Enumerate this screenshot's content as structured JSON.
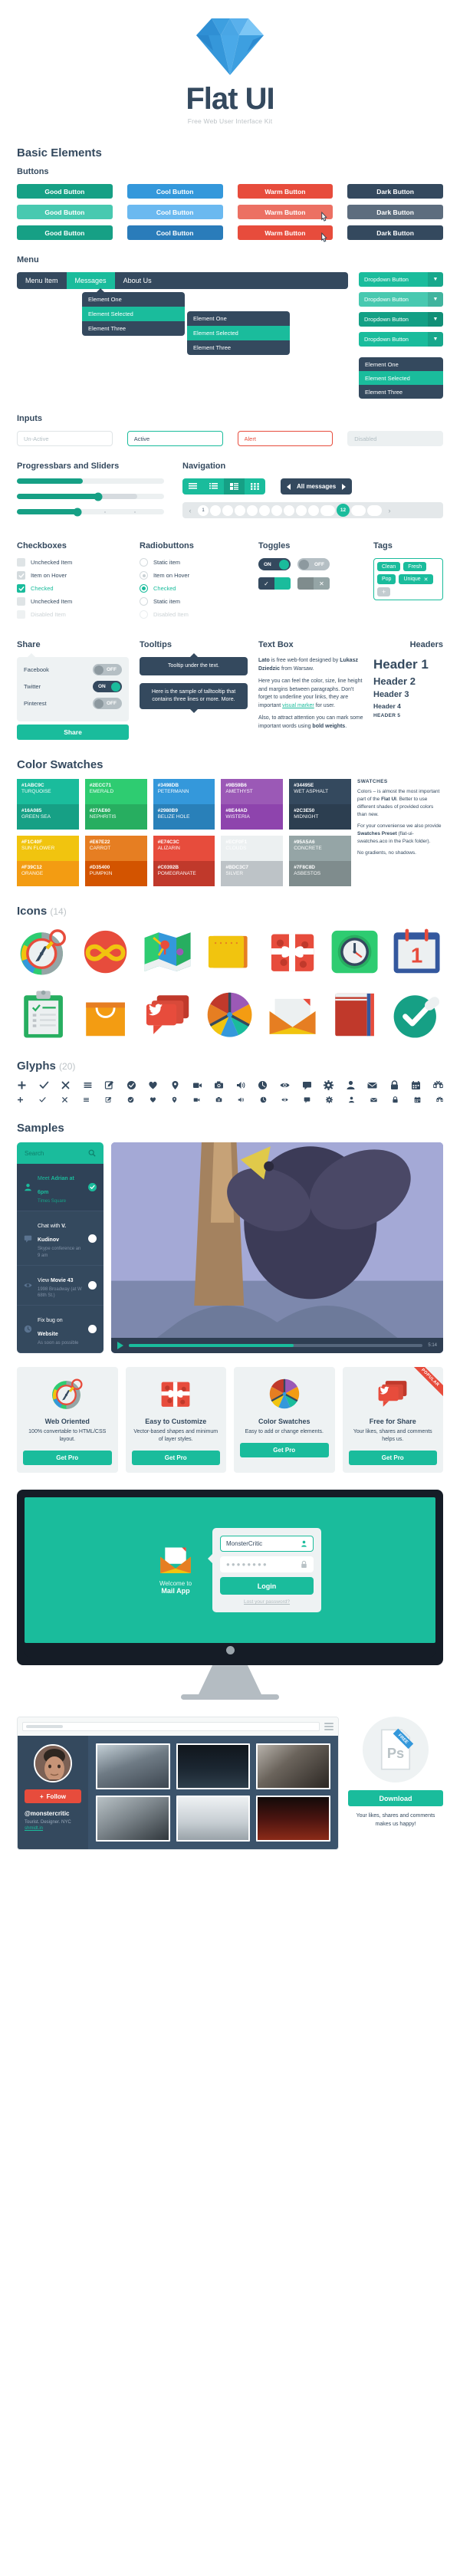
{
  "hero": {
    "title": "Flat UI",
    "subtitle": "Free Web User Interface Kit",
    "logo_icon": "diamond-icon"
  },
  "sections": {
    "basic_elements": "Basic Elements",
    "buttons": "Buttons",
    "menu": "Menu",
    "inputs": "Inputs",
    "progressbars": "Progressbars and Sliders",
    "navigation": "Navigation",
    "checkboxes": "Checkboxes",
    "radiobuttons": "Radiobuttons",
    "toggles": "Toggles",
    "tags": "Tags",
    "share": "Share",
    "tooltips": "Tooltips",
    "textbox": "Text Box",
    "headers": "Headers",
    "color_swatches": "Color Swatches",
    "icons": "Icons",
    "icons_count": "(14)",
    "glyphs": "Glyphs",
    "glyphs_count": "(20)",
    "samples": "Samples"
  },
  "buttons": {
    "rows": [
      [
        {
          "label": "Good Button",
          "cls": "b-good"
        },
        {
          "label": "Cool Button",
          "cls": "b-cool"
        },
        {
          "label": "Warm Button",
          "cls": "b-warm"
        },
        {
          "label": "Dark Button",
          "cls": "b-dark"
        }
      ],
      [
        {
          "label": "Good Button",
          "cls": "b-good-l"
        },
        {
          "label": "Cool Button",
          "cls": "b-cool-l"
        },
        {
          "label": "Warm Button",
          "cls": "b-warm-l"
        },
        {
          "label": "Dark Button",
          "cls": "b-dark-l"
        }
      ],
      [
        {
          "label": "Good Button",
          "cls": "b-good"
        },
        {
          "label": "Cool Button",
          "cls": "b-cool-d"
        },
        {
          "label": "Warm Button",
          "cls": "b-warm"
        },
        {
          "label": "Dark Button",
          "cls": "b-dark"
        }
      ]
    ]
  },
  "menu": {
    "items": [
      {
        "label": "Menu Item",
        "active": false
      },
      {
        "label": "Messages",
        "active": true
      },
      {
        "label": "About Us",
        "active": false
      }
    ],
    "popover_items": [
      "Element One",
      "Element Selected",
      "Element Three"
    ],
    "dropdown_label": "Dropdown Button",
    "dropdown_caret": "▼",
    "dropdown_items": [
      "Element One",
      "Element Selected",
      "Element Three"
    ]
  },
  "inputs": [
    {
      "value": "",
      "placeholder": "Un-Active",
      "state": ""
    },
    {
      "value": "Active",
      "placeholder": "",
      "state": "active"
    },
    {
      "value": "Alert",
      "placeholder": "",
      "state": "alert"
    },
    {
      "value": "",
      "placeholder": "Disabled",
      "state": "disabled"
    }
  ],
  "sliders": [
    {
      "fill": 45,
      "knob": null,
      "secondary": null
    },
    {
      "fill": 55,
      "knob": 55,
      "secondary": 82
    },
    {
      "fill": 41,
      "knob": 41,
      "secondary": null
    }
  ],
  "navigation": {
    "view_icons": [
      "list-rows-icon",
      "list-lines-icon",
      "list-detail-icon",
      "grid-icon"
    ],
    "view_active_index": 2,
    "all_messages": "All messages",
    "pager": {
      "prev": "‹",
      "next": "›",
      "pages": [
        "1",
        "",
        "",
        "",
        "",
        "",
        "",
        "",
        "",
        "",
        ""
      ],
      "current": "12",
      "after": [
        "",
        ""
      ]
    }
  },
  "checkboxes": [
    {
      "label": "Unchecked Item",
      "state": "unchecked"
    },
    {
      "label": "Item on Hover",
      "state": "hover"
    },
    {
      "label": "Checked",
      "state": "checked"
    },
    {
      "label": "Unchecked Item",
      "state": "unchecked"
    },
    {
      "label": "Disabled Item",
      "state": "disabled"
    }
  ],
  "radiobuttons": [
    {
      "label": "Static item",
      "state": "static"
    },
    {
      "label": "Item on Hover",
      "state": "hover"
    },
    {
      "label": "Checked",
      "state": "checked"
    },
    {
      "label": "Static item",
      "state": "static"
    },
    {
      "label": "Disabled Item",
      "state": "disabled"
    }
  ],
  "toggles": {
    "on_label": "ON",
    "off_label": "OFF",
    "check_glyph": "✓",
    "cross_glyph": "✕"
  },
  "tags": {
    "items": [
      "Clean",
      "Fresh",
      "Pop",
      "Unique"
    ],
    "removable": "Unique",
    "remove_glyph": "✕",
    "add_glyph": "+"
  },
  "share": {
    "rows": [
      {
        "label": "Facebook",
        "state": "off",
        "text": "OFF"
      },
      {
        "label": "Twitter",
        "state": "on",
        "text": "ON"
      },
      {
        "label": "Pinterest",
        "state": "off",
        "text": "OFF"
      }
    ],
    "button": "Share"
  },
  "tooltips": {
    "short": "Tooltip under the text.",
    "long": "Here is the sample of talltooltip that contains three lines or more. More."
  },
  "textbox": {
    "p1_a": "Lato",
    "p1_b": " is free web-font designed by ",
    "p1_c": "Lukasz Dziedzic",
    "p1_d": " from Warsaw.",
    "p2_a": "Here you can feel the color, size, line height and margins between paragraphs. Don't forget to underline your links, they are important ",
    "p2_link": "visual marker",
    "p2_b": " for user.",
    "p3_a": "Also, to attract attention you can mark some important words using ",
    "p3_b": "bold weights",
    "p3_c": "."
  },
  "headers": {
    "h1": "Header 1",
    "h2": "Header 2",
    "h3": "Header 3",
    "h4": "Header 4",
    "h5": "HEADER 5"
  },
  "color_swatches": {
    "columns": [
      [
        {
          "hex": "#1ABC9C",
          "name": "TURQUOISE",
          "color": "#1abc9c"
        },
        {
          "hex": "#16A085",
          "name": "GREEN SEA",
          "color": "#16a085"
        }
      ],
      [
        {
          "hex": "#2ECC71",
          "name": "EMERALD",
          "color": "#2ecc71"
        },
        {
          "hex": "#27AE60",
          "name": "NEPHRITIS",
          "color": "#27ae60"
        }
      ],
      [
        {
          "hex": "#3498DB",
          "name": "PETERMANN",
          "color": "#3498db"
        },
        {
          "hex": "#2980B9",
          "name": "BELIZE HOLE",
          "color": "#2980b9"
        }
      ],
      [
        {
          "hex": "#9B59B6",
          "name": "AMETHYST",
          "color": "#9b59b6"
        },
        {
          "hex": "#8E44AD",
          "name": "WISTERIA",
          "color": "#8e44ad"
        }
      ],
      [
        {
          "hex": "#34495E",
          "name": "WET ASPHALT",
          "color": "#34495e"
        },
        {
          "hex": "#2C3E50",
          "name": "MIDNIGHT",
          "color": "#2c3e50"
        }
      ],
      [
        {
          "hex": "#F1C40F",
          "name": "SUN FLOWER",
          "color": "#f1c40f"
        },
        {
          "hex": "#F39C12",
          "name": "ORANGE",
          "color": "#f39c12"
        }
      ],
      [
        {
          "hex": "#E67E22",
          "name": "CARROT",
          "color": "#e67e22"
        },
        {
          "hex": "#D35400",
          "name": "PUMPKIN",
          "color": "#d35400"
        }
      ],
      [
        {
          "hex": "#E74C3C",
          "name": "ALIZARIN",
          "color": "#e74c3c"
        },
        {
          "hex": "#C0392B",
          "name": "POMEGRANATE",
          "color": "#c0392b"
        }
      ],
      [
        {
          "hex": "#ECF0F1",
          "name": "CLOUDS",
          "color": "#ecf0f1",
          "dark_text": true
        },
        {
          "hex": "#BDC3C7",
          "name": "SILVER",
          "color": "#bdc3c7"
        }
      ],
      [
        {
          "hex": "#95A5A6",
          "name": "CONCRETE",
          "color": "#95a5a6"
        },
        {
          "hex": "#7F8C8D",
          "name": "ASBESTOS",
          "color": "#7f8c8d"
        }
      ]
    ],
    "side": {
      "title": "SWATCHES",
      "p1_a": "Colors – is almost the most important part of the ",
      "p1_b": "Flat UI",
      "p1_c": ". Better to use different shades of provided colors than new.",
      "p2_a": "For your conveniense we also provide ",
      "p2_b": "Swatches Preset",
      "p2_c": " (flat-ui-swatches.aco in the Pack folder).",
      "p3": "No gradients, no shadows."
    }
  },
  "icons": [
    "compass-icon",
    "infinity-heart-icon",
    "map-icon",
    "notepad-icon",
    "gift-icon",
    "clock-icon",
    "calendar-icon",
    "clipboard-icon",
    "shopping-bag-icon",
    "twitter-chat-icon",
    "color-wheel-icon",
    "envelope-icon",
    "notebook-icon",
    "check-circle-icon"
  ],
  "glyphs": [
    "plus-glyph",
    "check-glyph",
    "close-glyph",
    "menu-glyph",
    "edit-glyph",
    "check-circle-glyph",
    "heart-glyph",
    "pin-glyph",
    "video-glyph",
    "camera-glyph",
    "volume-glyph",
    "clock-glyph",
    "eye-glyph",
    "comment-glyph",
    "gear-glyph",
    "user-glyph",
    "mail-glyph",
    "lock-glyph",
    "calendar-glyph",
    "command-glyph"
  ],
  "todo_app": {
    "search_placeholder": "Search",
    "search_icon": "search-icon",
    "items": [
      {
        "title_a": "Meet ",
        "title_b": "Adrian at 6pm",
        "sub": "Times Square",
        "icon": "user-icon",
        "done": true
      },
      {
        "title_a": "Chat with ",
        "title_b": "V. Kudinov",
        "sub": "Skype conference an 9 am",
        "icon": "comment-icon",
        "done": false
      },
      {
        "title_a": "View ",
        "title_b": "Movie 43",
        "sub": "1998 Broadway (at W 68th St.)",
        "icon": "eye-icon",
        "done": false
      },
      {
        "title_a": "Fix bug on ",
        "title_b": "Website",
        "sub": "As soon as possible",
        "icon": "clock-icon",
        "done": false
      }
    ]
  },
  "player": {
    "play_icon": "play-icon",
    "time": "5:14",
    "progress": 56
  },
  "features": [
    {
      "title": "Web Oriented",
      "desc": "100% convertable to HTML/CSS layout.",
      "button": "Get Pro",
      "icon": "compass-icon",
      "ribbon": ""
    },
    {
      "title": "Easy to Customize",
      "desc": "Vector-based shapes and minimum of layer styles.",
      "button": "Get Pro",
      "icon": "gift-icon",
      "ribbon": ""
    },
    {
      "title": "Color Swatches",
      "desc": "Easy to add or change elements.",
      "button": "Get Pro",
      "icon": "color-wheel-icon",
      "ribbon": ""
    },
    {
      "title": "Free for Share",
      "desc": "Your likes, shares and comments helps us.",
      "button": "Get Pro",
      "icon": "twitter-chat-icon",
      "ribbon": "POPULAR"
    }
  ],
  "mail_app": {
    "welcome_line1": "Welcome to",
    "welcome_line2": "Mail App",
    "username": "MonsterCritic",
    "password_dots": "●●●●●●●●",
    "login_button": "Login",
    "lost_password": "Lost your password?",
    "user_icon": "user-icon",
    "lock_icon": "lock-icon",
    "envelope_icon": "envelope-icon"
  },
  "gallery": {
    "follow_button": "Follow",
    "follow_plus": "+",
    "handle": "@monstercritic",
    "bio": "Tourist. Designer. NYC",
    "link": "shmidt.in",
    "menu_icon": "hamburger-icon"
  },
  "download": {
    "badge": "FREE",
    "file_label": "Ps",
    "button": "Download",
    "note": "Your likes, shares and comments makes us happy!"
  },
  "colors": {
    "turquoise": "#1abc9c",
    "green_sea": "#16a085",
    "wet_asphalt": "#34495e",
    "alizarin": "#e74c3c",
    "peter_river": "#3498db",
    "clouds": "#ecf0f1"
  }
}
